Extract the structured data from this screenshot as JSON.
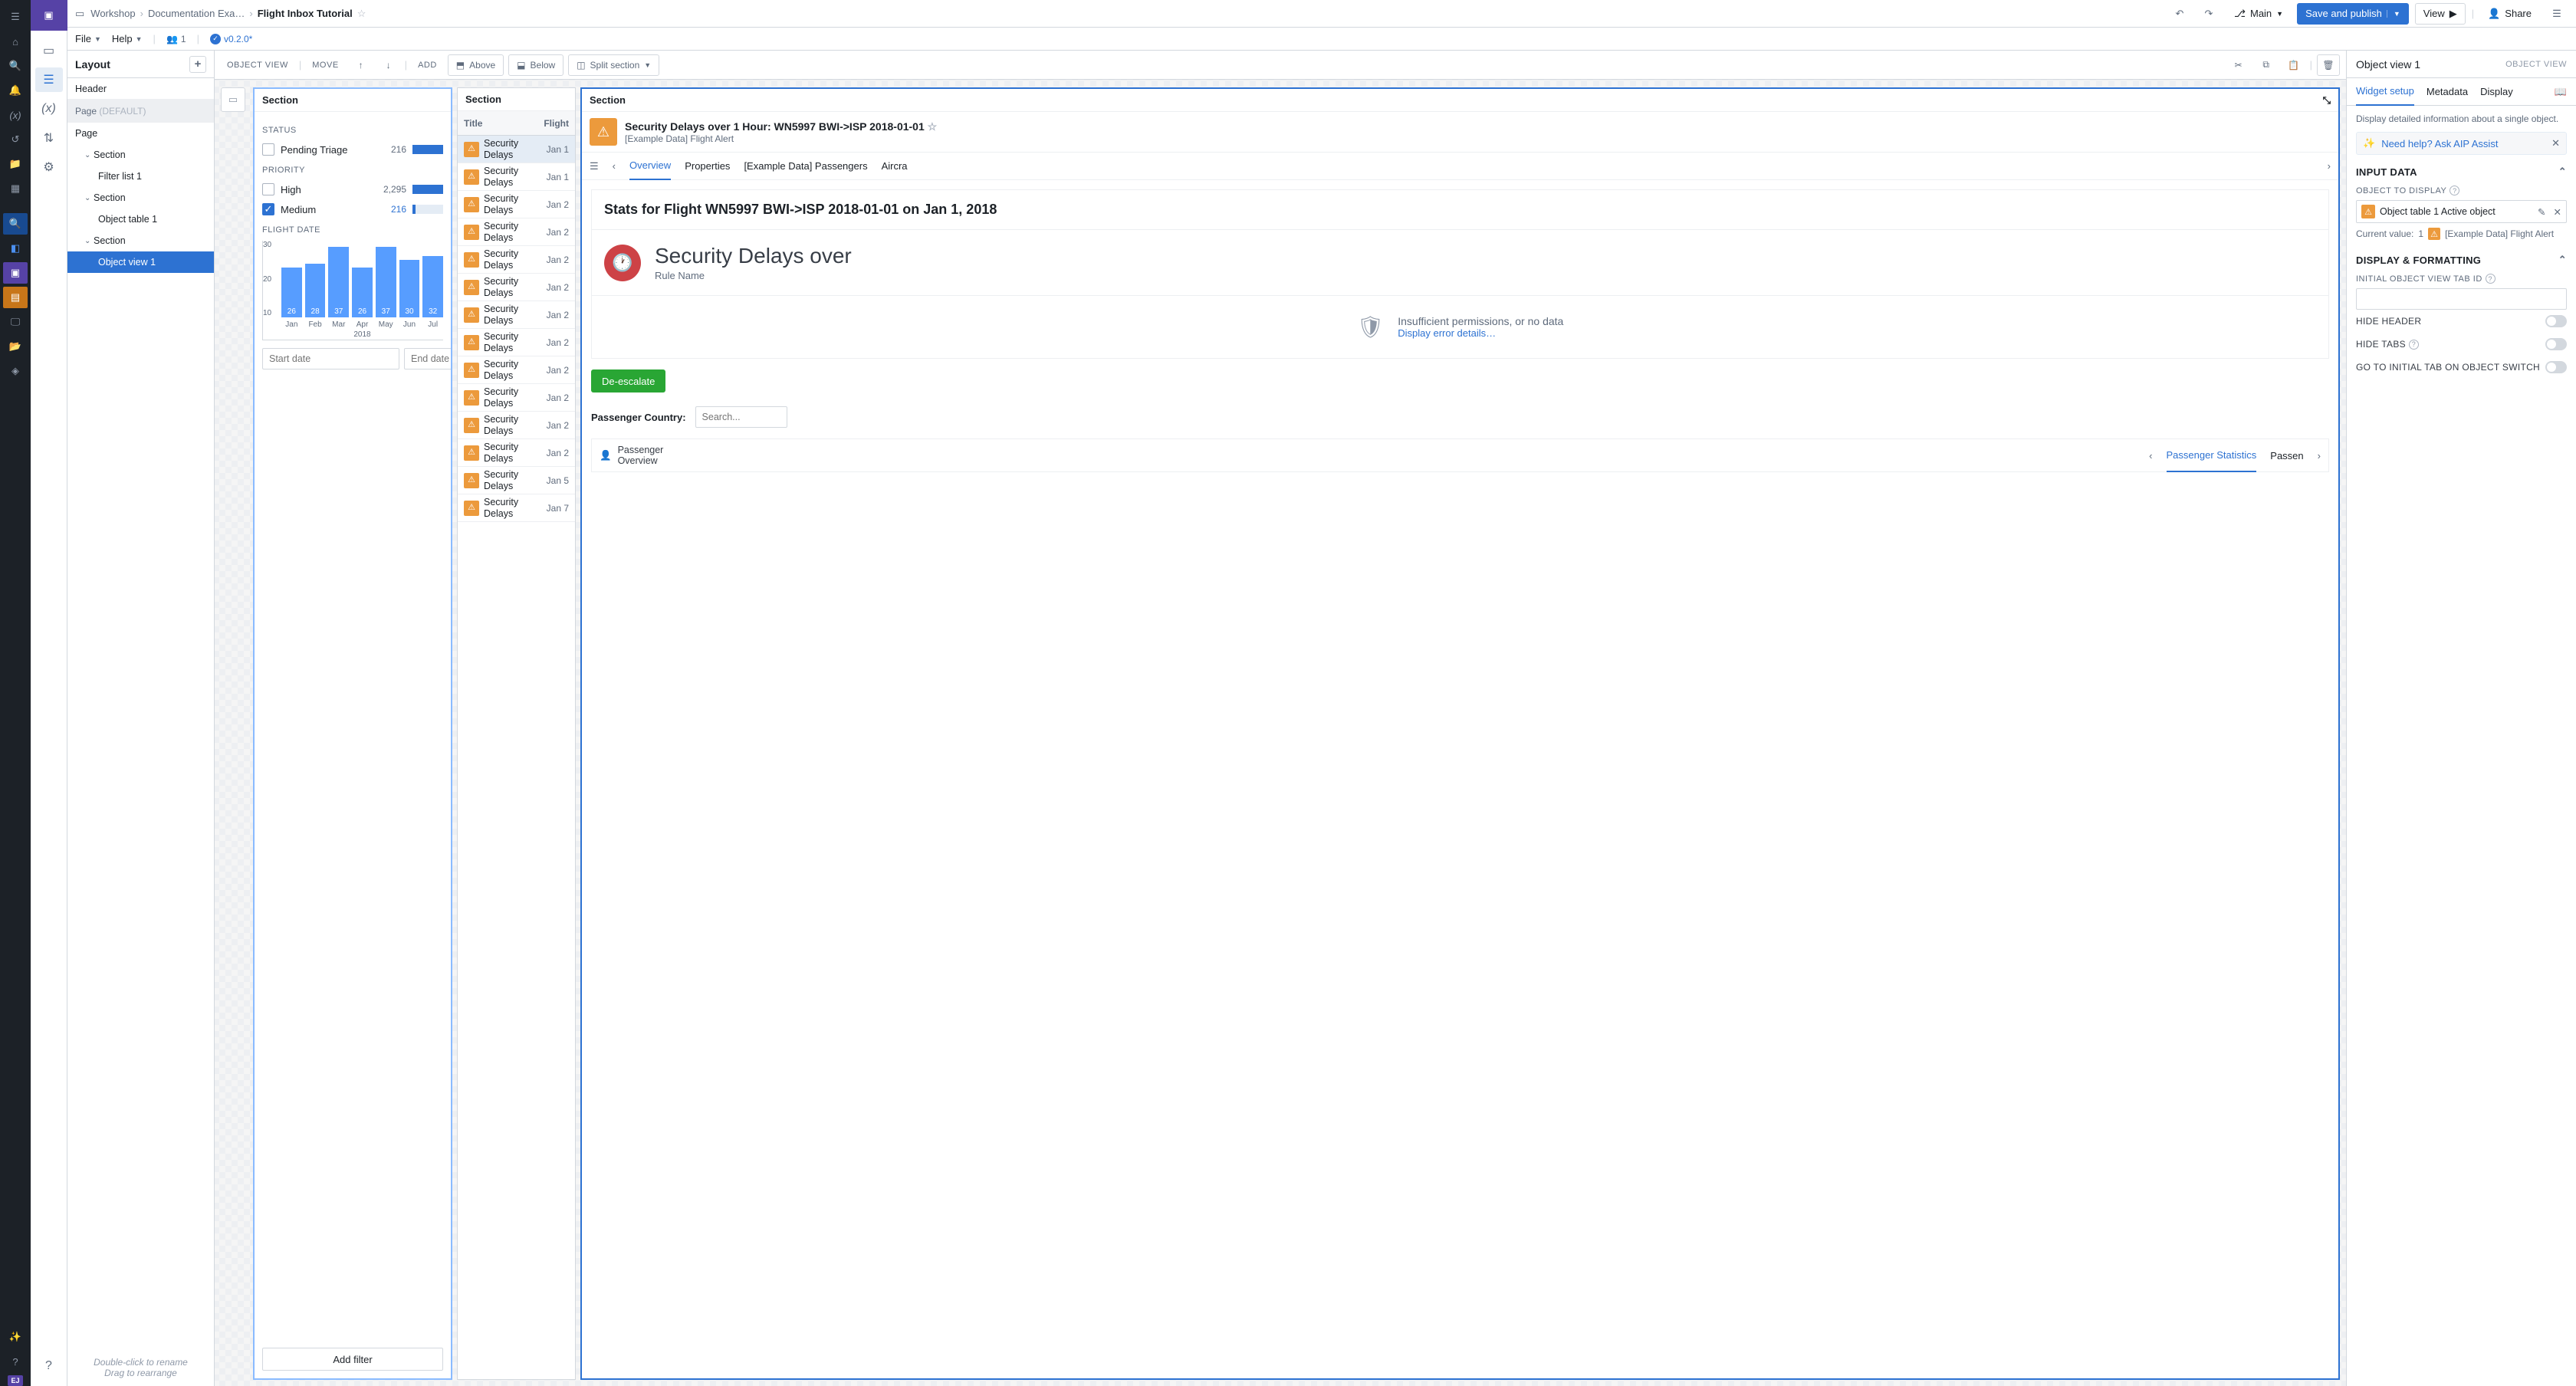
{
  "breadcrumb": {
    "workshop": "Workshop",
    "folder": "Documentation Exa…",
    "current": "Flight Inbox Tutorial"
  },
  "menubar": {
    "file": "File",
    "help": "Help",
    "users": "1",
    "version": "v0.2.0*"
  },
  "topbar": {
    "branch": "Main",
    "save": "Save and publish",
    "view": "View",
    "share": "Share"
  },
  "layout": {
    "title": "Layout",
    "header": "Header",
    "page_default": "Page",
    "default_tag": "(DEFAULT)",
    "page": "Page",
    "tree": {
      "s1": "Section",
      "fl1": "Filter list 1",
      "s2": "Section",
      "ot1": "Object table 1",
      "s3": "Section",
      "ov1": "Object view 1"
    },
    "hint1": "Double-click to rename",
    "hint2": "Drag to rearrange"
  },
  "canvas_toolbar": {
    "object_view": "OBJECT VIEW",
    "move": "MOVE",
    "add": "ADD",
    "above": "Above",
    "below": "Below",
    "split": "Split section"
  },
  "filter_panel": {
    "title": "Section",
    "status_label": "STATUS",
    "status": [
      {
        "label": "Pending Triage",
        "count": "216",
        "pct": 100
      }
    ],
    "priority_label": "PRIORITY",
    "priority": [
      {
        "label": "High",
        "count": "2,295",
        "pct": 100,
        "checked": false
      },
      {
        "label": "Medium",
        "count": "216",
        "pct": 9,
        "checked": true
      }
    ],
    "flightdate_label": "FLIGHT DATE",
    "start_ph": "Start date",
    "end_ph": "End date",
    "add_filter": "Add filter"
  },
  "chart_data": {
    "type": "bar",
    "categories": [
      "Jan",
      "Feb",
      "Mar",
      "Apr",
      "May",
      "Jun",
      "Jul"
    ],
    "values": [
      26,
      28,
      37,
      26,
      37,
      30,
      32
    ],
    "title": "",
    "xlabel": "2018",
    "ylabel": "",
    "ylim": [
      0,
      40
    ],
    "yticks": [
      10,
      20,
      30
    ]
  },
  "table_panel": {
    "title": "Section",
    "col_title": "Title",
    "col_flight": "Flight",
    "rows": [
      {
        "title": "Security Delays",
        "date": "Jan 1"
      },
      {
        "title": "Security Delays",
        "date": "Jan 1"
      },
      {
        "title": "Security Delays",
        "date": "Jan 2"
      },
      {
        "title": "Security Delays",
        "date": "Jan 2"
      },
      {
        "title": "Security Delays",
        "date": "Jan 2"
      },
      {
        "title": "Security Delays",
        "date": "Jan 2"
      },
      {
        "title": "Security Delays",
        "date": "Jan 2"
      },
      {
        "title": "Security Delays",
        "date": "Jan 2"
      },
      {
        "title": "Security Delays",
        "date": "Jan 2"
      },
      {
        "title": "Security Delays",
        "date": "Jan 2"
      },
      {
        "title": "Security Delays",
        "date": "Jan 2"
      },
      {
        "title": "Security Delays",
        "date": "Jan 2"
      },
      {
        "title": "Security Delays",
        "date": "Jan 5"
      },
      {
        "title": "Security Delays",
        "date": "Jan 7"
      }
    ]
  },
  "object_view": {
    "title": "Section",
    "heading": "Security Delays over 1 Hour: WN5997 BWI->ISP 2018-01-01",
    "subtitle": "[Example Data] Flight Alert",
    "tabs": {
      "overview": "Overview",
      "properties": "Properties",
      "passengers": "[Example Data] Passengers",
      "aircraft": "Aircra"
    },
    "stat": "Stats for Flight WN5997 BWI->ISP 2018-01-01 on Jan 1, 2018",
    "rule_title": "Security Delays over",
    "rule_sub": "Rule Name",
    "perm_text": "Insufficient permissions, or no data",
    "perm_link": "Display error details…",
    "deescalate": "De-escalate",
    "pass_country": "Passenger Country:",
    "search_ph": "Search...",
    "pass_overview": "Passenger\nOverview",
    "pt_stats": "Passenger Statistics",
    "pt_passen": "Passen"
  },
  "config": {
    "title": "Object view 1",
    "tag": "OBJECT VIEW",
    "tabs": {
      "widget": "Widget setup",
      "metadata": "Metadata",
      "display": "Display"
    },
    "help": "Display detailed information about a single object.",
    "aip": "Need help? Ask AIP Assist",
    "input_data": "INPUT DATA",
    "obj_to_display": "OBJECT TO DISPLAY",
    "obj_value": "Object table 1 Active object",
    "cur_label": "Current value:",
    "cur_count": "1",
    "cur_type": "[Example Data] Flight Alert",
    "display_fmt": "DISPLAY & FORMATTING",
    "init_tab": "INITIAL OBJECT VIEW TAB ID",
    "hide_header": "HIDE HEADER",
    "hide_tabs": "HIDE TABS",
    "goto_initial": "GO TO INITIAL TAB ON OBJECT SWITCH"
  }
}
